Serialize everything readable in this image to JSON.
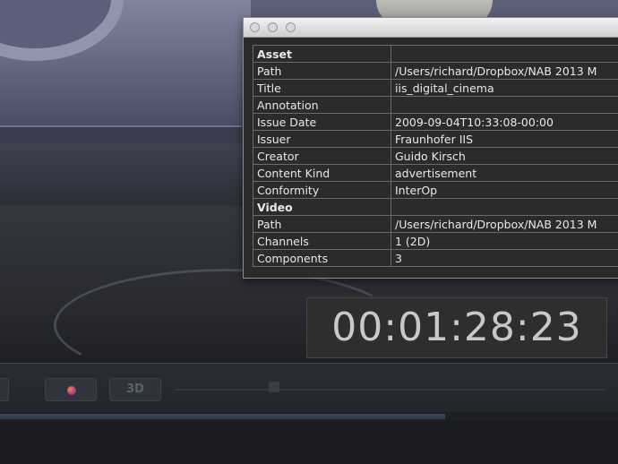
{
  "metadata": {
    "rows": [
      {
        "key": "Asset",
        "value": "",
        "section": true
      },
      {
        "key": "Path",
        "value": "/Users/richard/Dropbox/NAB 2013 M",
        "section": false
      },
      {
        "key": "Title",
        "value": "iis_digital_cinema",
        "section": false
      },
      {
        "key": "Annotation",
        "value": "",
        "section": false
      },
      {
        "key": "Issue Date",
        "value": "2009-09-04T10:33:08-00:00",
        "section": false
      },
      {
        "key": "Issuer",
        "value": "Fraunhofer IIS",
        "section": false
      },
      {
        "key": "Creator",
        "value": "Guido Kirsch",
        "section": false
      },
      {
        "key": "Content Kind",
        "value": "advertisement",
        "section": false
      },
      {
        "key": "Conformity",
        "value": "InterOp",
        "section": false
      },
      {
        "key": "Video",
        "value": "",
        "section": true
      },
      {
        "key": "Path",
        "value": "/Users/richard/Dropbox/NAB 2013 M",
        "section": false
      },
      {
        "key": "Channels",
        "value": "1 (2D)",
        "section": false
      },
      {
        "key": "Components",
        "value": "3",
        "section": false
      }
    ]
  },
  "timecode": "00:01:28:23",
  "controls": {
    "three_d_label": "3D",
    "color_button_icon": "color-wheel-icon"
  },
  "playback": {
    "progress_fraction": 0.72
  }
}
